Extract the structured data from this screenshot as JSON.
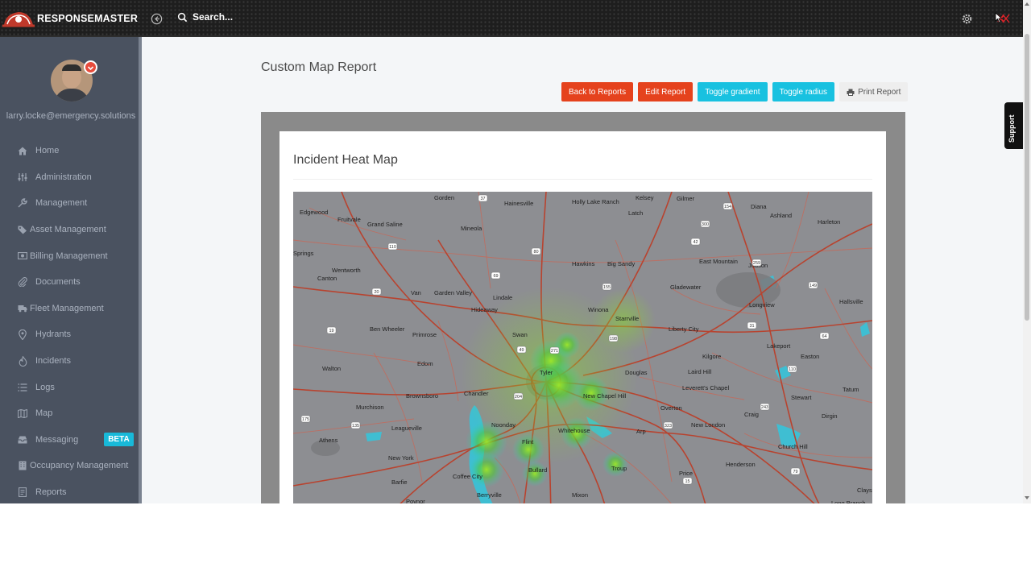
{
  "app": {
    "brand": "RESPONSEMASTER"
  },
  "header": {
    "search_placeholder": "Search..."
  },
  "user": {
    "email": "larry.locke@emergency.solutions"
  },
  "sidebar": {
    "items": [
      {
        "label": "Home",
        "icon": "home-icon"
      },
      {
        "label": "Administration",
        "icon": "sliders-icon"
      },
      {
        "label": "Management",
        "icon": "wrench-icon"
      },
      {
        "label": "Asset Management",
        "icon": "tags-icon"
      },
      {
        "label": "Billing Management",
        "icon": "money-icon"
      },
      {
        "label": "Documents",
        "icon": "paperclip-icon"
      },
      {
        "label": "Fleet Management",
        "icon": "truck-icon"
      },
      {
        "label": "Hydrants",
        "icon": "map-marker-icon"
      },
      {
        "label": "Incidents",
        "icon": "fire-icon"
      },
      {
        "label": "Logs",
        "icon": "list-icon"
      },
      {
        "label": "Map",
        "icon": "map-icon"
      },
      {
        "label": "Messaging",
        "icon": "inbox-icon",
        "badge": "BETA"
      },
      {
        "label": "Occupancy Management",
        "icon": "building-icon"
      },
      {
        "label": "Reports",
        "icon": "report-icon"
      }
    ]
  },
  "page": {
    "title": "Custom Map Report",
    "actions": {
      "back": "Back to Reports",
      "edit": "Edit Report",
      "toggle_gradient": "Toggle gradient",
      "toggle_radius": "Toggle radius",
      "print": "Print Report"
    },
    "card_title": "Incident Heat Map"
  },
  "support_tab": "Support",
  "map": {
    "places": [
      "Gorden",
      "Edgewood",
      "Fruitvale",
      "Grand Saline",
      "Mineola",
      "Hainesville",
      "Holly Lake Ranch",
      "Kelsey",
      "Gilmer",
      "Diana",
      "Ashland",
      "Harleton",
      "Latch",
      "Springs",
      "Wentworth",
      "Canton",
      "Van",
      "Garden Valley",
      "Lindale",
      "Hawkins",
      "Big Sandy",
      "East Mountain",
      "Judson",
      "Gladewater",
      "Hideaway",
      "Winona",
      "Starrville",
      "Longview",
      "Hallsville",
      "Ben Wheeler",
      "Primrose",
      "Swan",
      "Liberty City",
      "Kilgore",
      "Lakeport",
      "Easton",
      "Walton",
      "Edom",
      "Tyler",
      "Douglas",
      "Laird Hill",
      "Leverett's Chapel",
      "Brownsboro",
      "Chandler",
      "New Chapel Hill",
      "Overton",
      "Craig",
      "Stewart",
      "Tatum",
      "Murchison",
      "Leagueville",
      "Noonday",
      "Whitehouse",
      "Arp",
      "New London",
      "Dirgin",
      "Athens",
      "Flint",
      "Church Hill",
      "New York",
      "Bullard",
      "Troup",
      "Henderson",
      "Barfie",
      "Coffee City",
      "Price",
      "Berryville",
      "Mixon",
      "Poynor",
      "Long Branch",
      "Clays"
    ],
    "highways": [
      "37",
      "80",
      "110",
      "69",
      "155",
      "300",
      "154",
      "259",
      "20",
      "271",
      "42",
      "31",
      "149",
      "64",
      "135",
      "175",
      "19",
      "49",
      "198",
      "110",
      "323",
      "15",
      "243",
      "79",
      "204"
    ]
  }
}
